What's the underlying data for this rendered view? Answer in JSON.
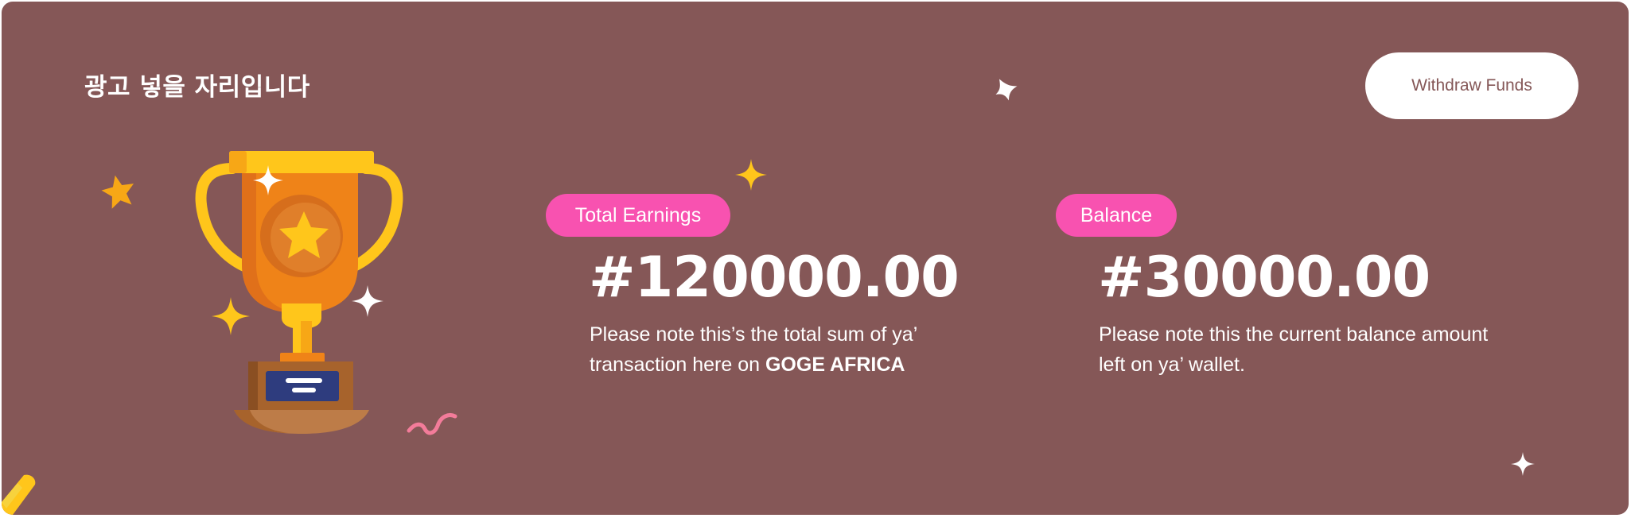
{
  "ad_banner": {
    "title": "광고 넣을 자리입니다"
  },
  "header": {
    "withdraw_label": "Withdraw Funds"
  },
  "stats": {
    "earnings": {
      "label": "Total Earnings",
      "amount": "#120000.00",
      "desc_prefix": "Please note this’s the total sum of ya’ transaction here on ",
      "desc_emphasis": "GOGE AFRICA"
    },
    "balance": {
      "label": "Balance",
      "amount": "#30000.00",
      "desc": "Please note this the current balance amount left on ya’ wallet."
    }
  },
  "colors": {
    "background": "#855757",
    "accent_pill": "#f852b0",
    "button_bg": "#ffffff",
    "button_text": "#855757",
    "trophy_gold": "#ffc61b",
    "trophy_orange": "#ef8318"
  },
  "icons": {
    "trophy": "trophy-illustration",
    "sparkle": "sparkle-icon",
    "star": "star-icon",
    "squiggle": "squiggle-decoration"
  }
}
